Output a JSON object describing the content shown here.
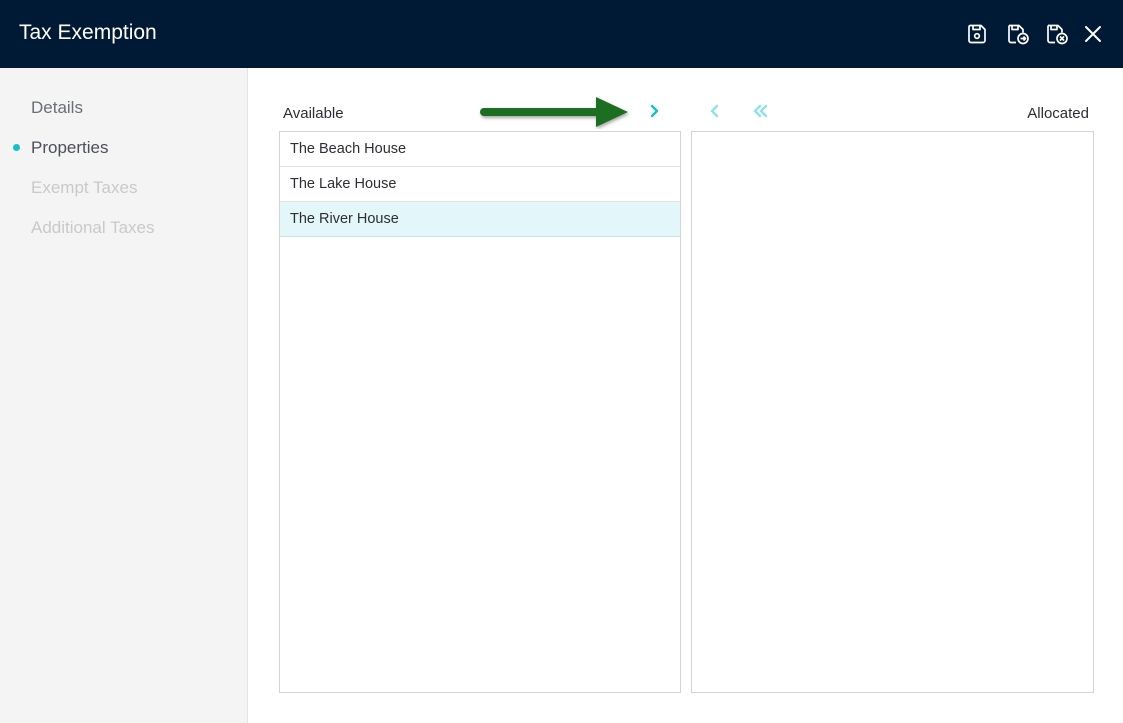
{
  "header": {
    "title": "Tax Exemption",
    "actions": [
      {
        "name": "save-icon",
        "label": "Save"
      },
      {
        "name": "save-and-new-icon",
        "label": "Save and New"
      },
      {
        "name": "save-and-close-icon",
        "label": "Save and Close"
      },
      {
        "name": "close-icon",
        "label": "Close"
      }
    ]
  },
  "sidebar": {
    "items": [
      {
        "label": "Details",
        "state": "complete"
      },
      {
        "label": "Properties",
        "state": "active"
      },
      {
        "label": "Exempt Taxes",
        "state": "disabled"
      },
      {
        "label": "Additional Taxes",
        "state": "disabled"
      }
    ]
  },
  "transfer": {
    "available_label": "Available",
    "allocated_label": "Allocated",
    "controls": [
      {
        "name": "move-right-icon",
        "glyph": "›"
      },
      {
        "name": "move-left-icon",
        "glyph": "‹"
      },
      {
        "name": "move-all-left-icon",
        "glyph": "«"
      }
    ],
    "available_items": [
      {
        "label": "The Beach House",
        "selected": false
      },
      {
        "label": "The Lake House",
        "selected": false
      },
      {
        "label": "The River House",
        "selected": true
      }
    ],
    "allocated_items": []
  },
  "annotation": {
    "arrow_color": "#1a6e21"
  },
  "colors": {
    "header_bg": "#001a35",
    "accent": "#14c0c8",
    "selected_row": "#e3f7fb",
    "sidebar_bg": "#f4f4f4"
  }
}
